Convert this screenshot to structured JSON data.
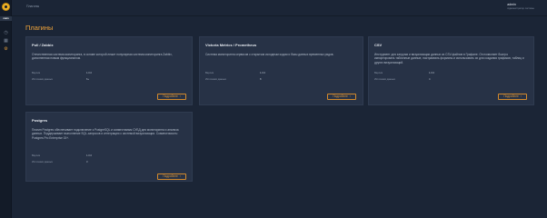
{
  "sidebar": {
    "label": "main",
    "icons": [
      "clock-icon",
      "grid-icon",
      "plugin-icon"
    ]
  },
  "header": {
    "breadcrumb": "Плагины",
    "user_name": "admin",
    "user_role": "Администратор системы"
  },
  "page": {
    "title": "Плагины"
  },
  "labels": {
    "version": "Версия",
    "data_sources": "Источники данных",
    "details_button": "Подробнее"
  },
  "plugins": [
    {
      "title": "Pull / Zabbix",
      "description": "Отечественная система мониторинга, в основе которой лежит популярная система мониторинга Zabbix, дополненная новым функционалом.",
      "version": "1.0.0",
      "sources": "6+"
    },
    {
      "title": "Victoria Metrics / Prometheus",
      "description": "Система мониторинга сервисов с открытым исходным кодом и базы данных временных рядов.",
      "version": "1.0.0",
      "sources": "8"
    },
    {
      "title": "CSV",
      "description": "Инструмент для загрузки и визуализации данных из CSV-файлов в Графане. Он позволяет быстро импортировать табличные данные, настраивать форматы и использовать их для создания графиков, таблиц и других визуализаций.",
      "version": "1.0.0",
      "sources": "4"
    },
    {
      "title": "Postgres",
      "description": "Плагин Postgres обеспечивает подключение к PostgreSQL и совместимым СУБД для мониторинга и анализа данных. Поддерживает выполнение SQL-запросов и интеграцию с системой визуализации. Совместимость: Postgres Pro Enterprise 15+.",
      "version": "1.0.0",
      "sources": "3"
    }
  ]
}
